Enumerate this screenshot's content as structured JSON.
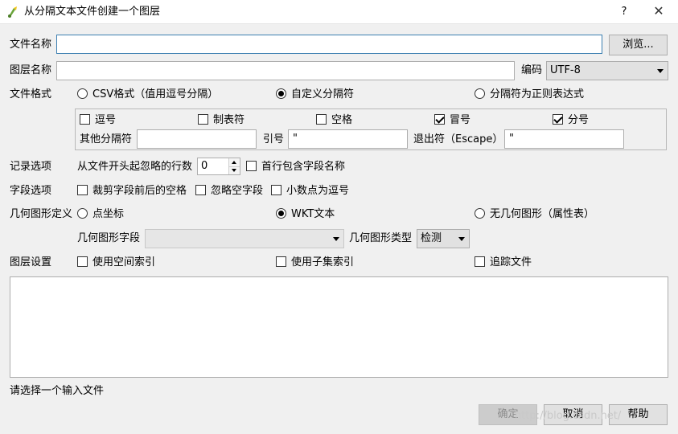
{
  "window": {
    "title": "从分隔文本文件创建一个图层",
    "help_label": "?",
    "close_label": "✕",
    "app_icon": "qgis-icon"
  },
  "file_name": {
    "label": "文件名称",
    "value": "",
    "browse_label": "浏览..."
  },
  "layer_name": {
    "label": "图层名称",
    "value": "",
    "encoding_label": "编码",
    "encoding_value": "UTF-8"
  },
  "file_format": {
    "label": "文件格式",
    "options": [
      {
        "label": "CSV格式（值用逗号分隔）",
        "checked": false
      },
      {
        "label": "自定义分隔符",
        "checked": true
      },
      {
        "label": "分隔符为正则表达式",
        "checked": false
      }
    ],
    "delimiters": [
      {
        "label": "逗号",
        "checked": false
      },
      {
        "label": "制表符",
        "checked": false
      },
      {
        "label": "空格",
        "checked": false
      },
      {
        "label": "冒号",
        "checked": true
      },
      {
        "label": "分号",
        "checked": true
      }
    ],
    "other_delimiter_label": "其他分隔符",
    "other_delimiter_value": "",
    "quote_label": "引号",
    "quote_value": "\"",
    "escape_label": "退出符（Escape）",
    "escape_value": "\""
  },
  "record_options": {
    "label": "记录选项",
    "skip_lines_label": "从文件开头起忽略的行数",
    "skip_lines_value": "0",
    "first_row_header_label": "首行包含字段名称",
    "first_row_header_checked": false
  },
  "field_options": {
    "label": "字段选项",
    "items": [
      {
        "label": "裁剪字段前后的空格",
        "checked": false
      },
      {
        "label": "忽略空字段",
        "checked": false
      },
      {
        "label": "小数点为逗号",
        "checked": false
      }
    ]
  },
  "geometry": {
    "label": "几何图形定义",
    "options": [
      {
        "label": "点坐标",
        "checked": false
      },
      {
        "label": "WKT文本",
        "checked": true
      },
      {
        "label": "无几何图形（属性表）",
        "checked": false
      }
    ],
    "field_label": "几何图形字段",
    "field_value": "",
    "type_label": "几何图形类型",
    "type_value": "检测"
  },
  "layer_settings": {
    "label": "图层设置",
    "items": [
      {
        "label": "使用空间索引",
        "checked": false
      },
      {
        "label": "使用子集索引",
        "checked": false
      },
      {
        "label": "追踪文件",
        "checked": false
      }
    ]
  },
  "status": {
    "message": "请选择一个输入文件"
  },
  "buttons": {
    "ok_label": "确定",
    "cancel_label": "取消",
    "help_label": "帮助"
  },
  "watermark": "http://blog.csdn.net/"
}
